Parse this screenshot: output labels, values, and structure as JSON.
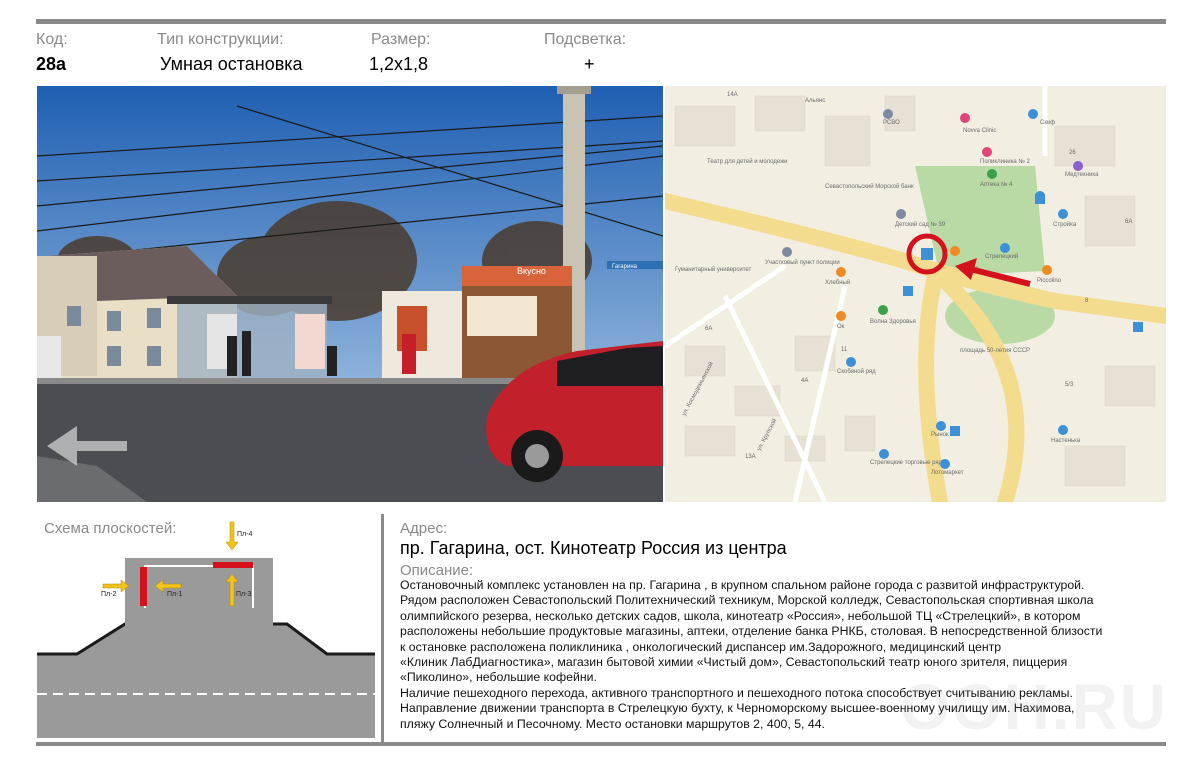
{
  "header": {
    "code_label": "Код:",
    "code_value": "28а",
    "type_label": "Тип конструкции:",
    "type_value": "Умная остановка",
    "size_label": "Размер:",
    "size_value": "1,2х1,8",
    "light_label": "Подсветка:",
    "light_value": "+"
  },
  "photo": {
    "kiosk_sign": "Вкусно",
    "street_sign": "Гагарина"
  },
  "map": {
    "pois": [
      "14А",
      "Альянс",
      "РСВО",
      "Novva Clinic",
      "Скиф",
      "Театр для детей и молодежи",
      "Поликлиника № 2",
      "Аптека № 4",
      "Медтехника",
      "26",
      "Севастопольский Морской банк",
      "Детский сад № 39",
      "Стройка",
      "6А",
      "Гуманитарный университет",
      "Участковый пункт полиции",
      "Стрелецкий",
      "Волна",
      "Хлебный",
      "Piccolino",
      "Ок",
      "Волна Здоровья",
      "площадь 50-летия СССР",
      "Скобяной ряд",
      "ул. Космодемьянской",
      "ул. Крупской",
      "Рынок",
      "Настенька",
      "Стрелецкие торговые ряды",
      "Лотомаркет",
      "11",
      "4А",
      "6А",
      "8",
      "5/3",
      "13А"
    ]
  },
  "scheme": {
    "title": "Схема плоскостей:",
    "labels": [
      "Пл-1",
      "Пл-2",
      "Пл-3",
      "Пл-4"
    ]
  },
  "address": {
    "label": "Адрес:",
    "value": "пр. Гагарина, ост. Кинотеатр Россия из центра"
  },
  "description": {
    "label": "Описание:",
    "lines": [
      "Остановочный комплекс установлен на пр. Гагарина , в крупном спальном районе города  с развитой инфраструктурой.",
      "Рядом расположен Севастопольский Политехнический техникум,  Морской колледж,  Севастопольская спортивная школа",
      "олимпийского резерва,  несколько детских садов, школа, кинотеатр «Россия», небольшой  ТЦ «Стрелецкий», в котором",
      "расположены небольшие продуктовые магазины, аптеки, отделение банка РНКБ, столовая. В непосредственной близости",
      "к остановке расположена поликлиника , онкологический диспансер им.Задорожного, медицинский центр",
      "«Клиник ЛабДиагностика», магазин бытовой химии «Чистый дом»,  Севастопольский театр юного зрителя, пиццерия",
      "«Пиколино», небольшие кофейни.",
      " Наличие пешеходного перехода, активного транспортного и пешеходного потока способствует    считыванию рекламы.",
      "Направление движении транспорта в Стрелецкую бухту, к  Черноморскому высшее-военному училищу им. Нахимова,",
      "пляжу Солнечный и Песочному.  Место остановки маршрутов 2, 400, 5, 44."
    ]
  },
  "watermark": "OOH.RU",
  "colors": {
    "rule_gray": "#8a8a8a",
    "label_gray": "#8a8a8a",
    "marker_red": "#d4121e",
    "arrow_yellow": "#f2c318",
    "plane_red": "#d4121e",
    "road_gray": "#9a9a9a",
    "map_road_yellow": "#f4dc8e",
    "map_green": "#b9d9a5"
  }
}
